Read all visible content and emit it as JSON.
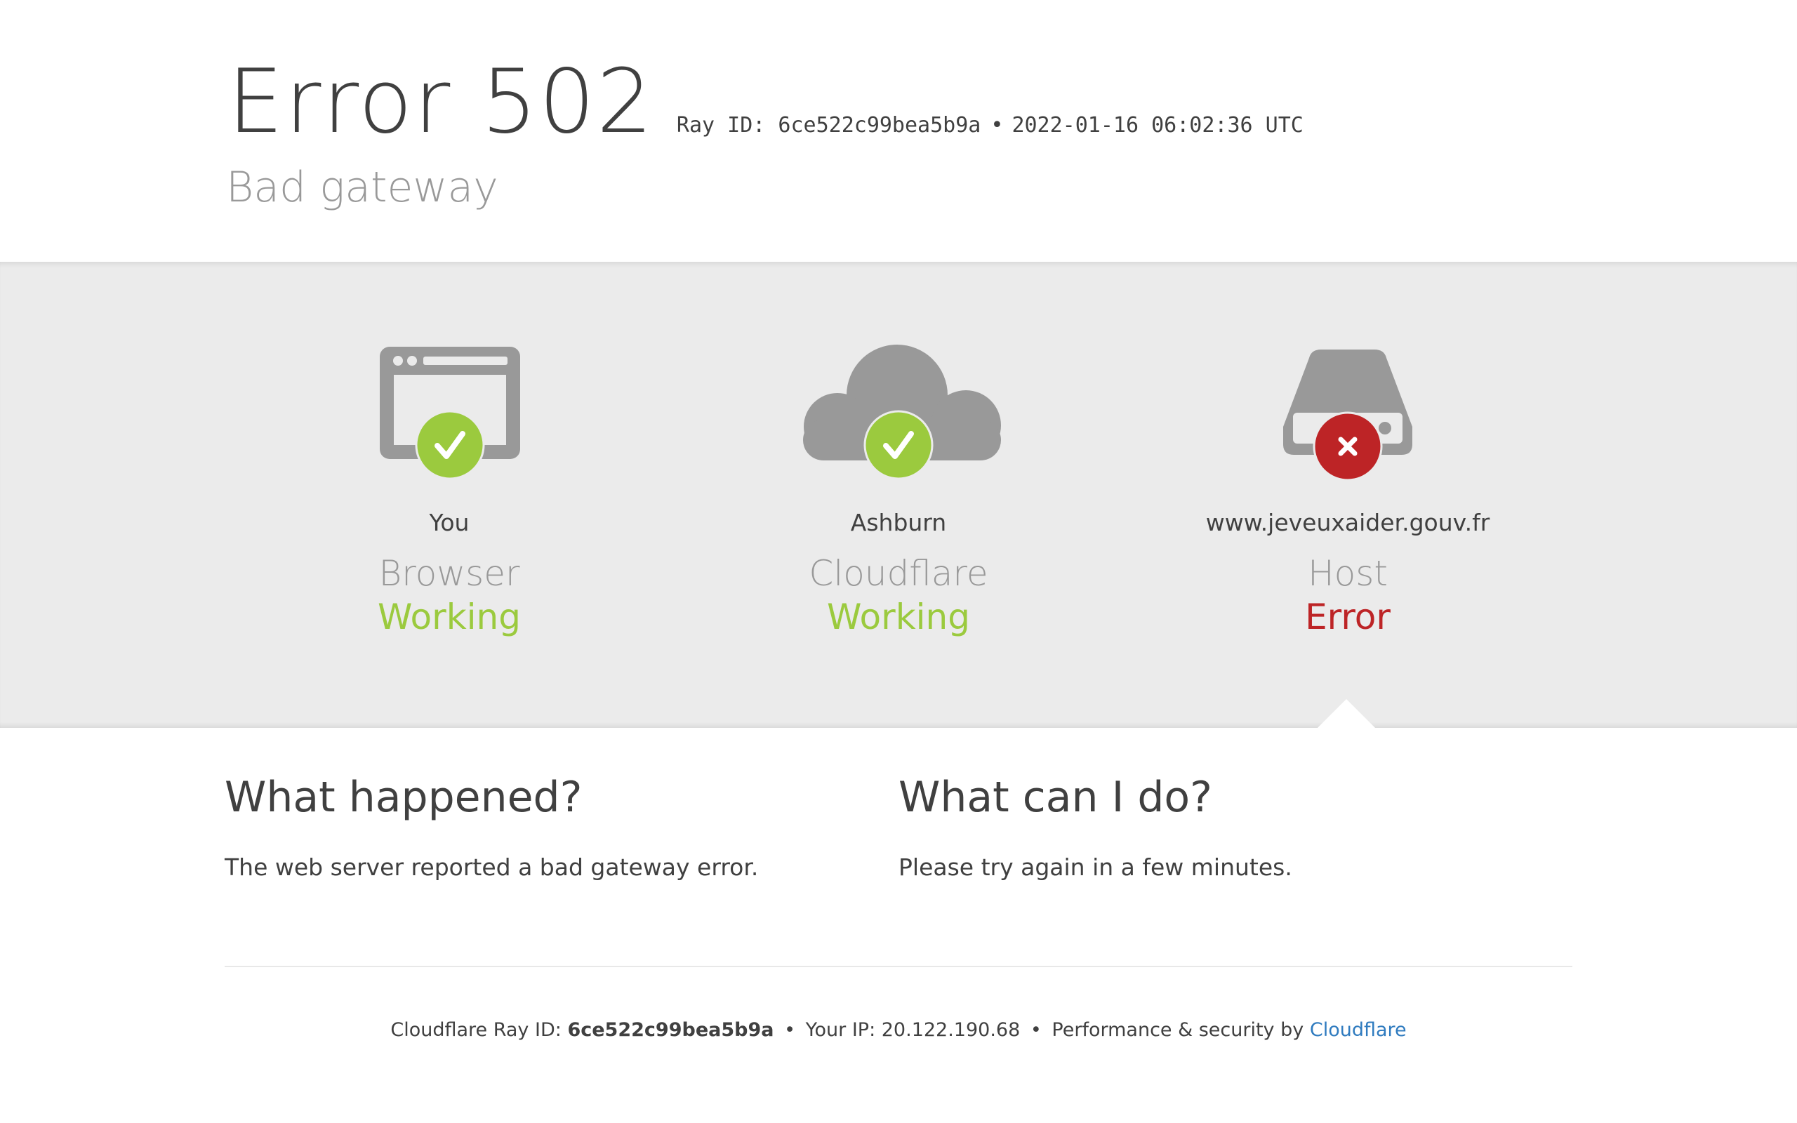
{
  "header": {
    "error_title": "Error 502",
    "ray_id_text": "Ray ID: 6ce522c99bea5b9a",
    "separator": "•",
    "timestamp": "2022-01-16 06:02:36 UTC",
    "subtitle": "Bad gateway"
  },
  "status": [
    {
      "location": "You",
      "role": "Browser",
      "state": "Working",
      "icon": "browser-icon",
      "badge": "check-icon"
    },
    {
      "location": "Ashburn",
      "role": "Cloudflare",
      "state": "Working",
      "icon": "cloud-icon",
      "badge": "check-icon"
    },
    {
      "location": "www.jeveuxaider.gouv.fr",
      "role": "Host",
      "state": "Error",
      "icon": "server-icon",
      "badge": "error-x-icon"
    }
  ],
  "colors": {
    "ok": "#9bca3e",
    "error": "#bd2426",
    "icon_gray": "#999999",
    "band_bg": "#ebebeb",
    "link": "#2f7bbf"
  },
  "what_happened": {
    "heading": "What happened?",
    "body": "The web server reported a bad gateway error."
  },
  "what_can_i_do": {
    "heading": "What can I do?",
    "body": "Please try again in a few minutes."
  },
  "footer": {
    "ray_label": "Cloudflare Ray ID:",
    "ray_value": "6ce522c99bea5b9a",
    "sep1": "•",
    "ip_text": "Your IP: 20.122.190.68",
    "sep2": "•",
    "perf_text": "Performance & security by",
    "link_text": "Cloudflare"
  }
}
